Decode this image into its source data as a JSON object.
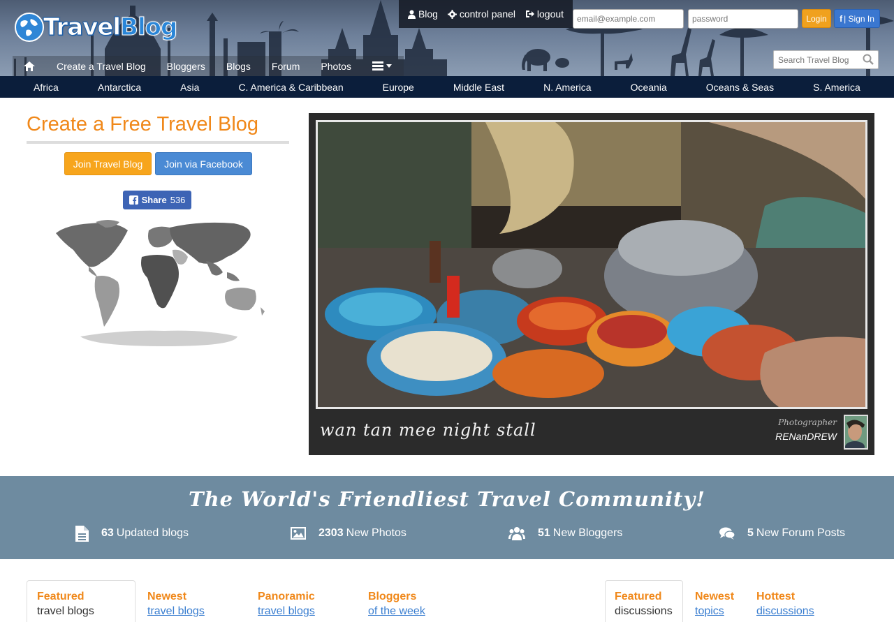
{
  "logo": {
    "part1": "Travel",
    "part2": "Blog"
  },
  "topbar": {
    "blog": "Blog",
    "control_panel": "control panel",
    "logout": "logout"
  },
  "login": {
    "email_placeholder": "email@example.com",
    "password_placeholder": "password",
    "login_label": "Login",
    "signin_label": "| Sign In"
  },
  "search": {
    "placeholder": "Search Travel Blog"
  },
  "nav": {
    "items": [
      "Create a Travel Blog",
      "Bloggers",
      "Blogs",
      "Forum",
      "Photos"
    ]
  },
  "regions": [
    "Africa",
    "Antarctica",
    "Asia",
    "C. America & Caribbean",
    "Europe",
    "Middle East",
    "N. America",
    "Oceania",
    "Oceans & Seas",
    "S. America"
  ],
  "left": {
    "title": "Create a Free Travel Blog",
    "join_label": "Join Travel Blog",
    "join_fb_label": "Join via Facebook",
    "share_label": "Share",
    "share_count": "536"
  },
  "photo": {
    "caption": "wan tan mee night stall",
    "photographer_label": "Photographer",
    "photographer": "RENanDREW"
  },
  "community": {
    "title": "The World's Friendliest Travel Community!",
    "stats": [
      {
        "count": "63",
        "label": "Updated blogs",
        "icon": "file-icon"
      },
      {
        "count": "2303",
        "label": "New Photos",
        "icon": "image-icon"
      },
      {
        "count": "51",
        "label": "New Bloggers",
        "icon": "users-icon"
      },
      {
        "count": "5",
        "label": "New Forum Posts",
        "icon": "comments-icon"
      }
    ]
  },
  "tabs": {
    "blogs": [
      {
        "top": "Featured",
        "bottom": "travel blogs"
      },
      {
        "top": "Newest",
        "bottom": "travel blogs"
      },
      {
        "top": "Panoramic",
        "bottom": "travel blogs"
      },
      {
        "top": "Bloggers",
        "bottom": "of the week"
      }
    ],
    "forum": [
      {
        "top": "Featured",
        "bottom": "discussions"
      },
      {
        "top": "Newest",
        "bottom": "topics"
      },
      {
        "top": "Hottest",
        "bottom": "discussions"
      }
    ]
  },
  "colors": {
    "accent": "#f0881a",
    "link": "#3a7ed0",
    "region_bar": "#0b1e3b",
    "community_bg": "#6e8ba0"
  }
}
